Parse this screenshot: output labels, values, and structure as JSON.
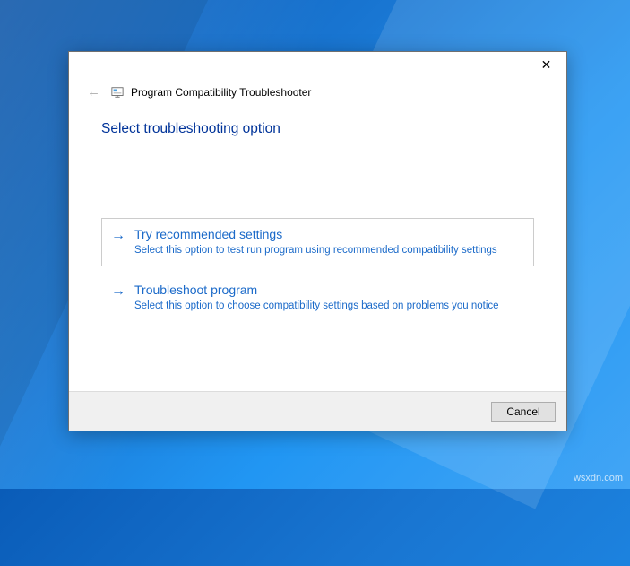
{
  "window": {
    "title": "Program Compatibility Troubleshooter"
  },
  "heading": "Select troubleshooting option",
  "options": {
    "recommended": {
      "title": "Try recommended settings",
      "desc": "Select this option to test run program using recommended compatibility settings"
    },
    "troubleshoot": {
      "title": "Troubleshoot program",
      "desc": "Select this option to choose compatibility settings based on problems you notice"
    }
  },
  "buttons": {
    "cancel": "Cancel"
  },
  "watermark": "wsxdn.com"
}
